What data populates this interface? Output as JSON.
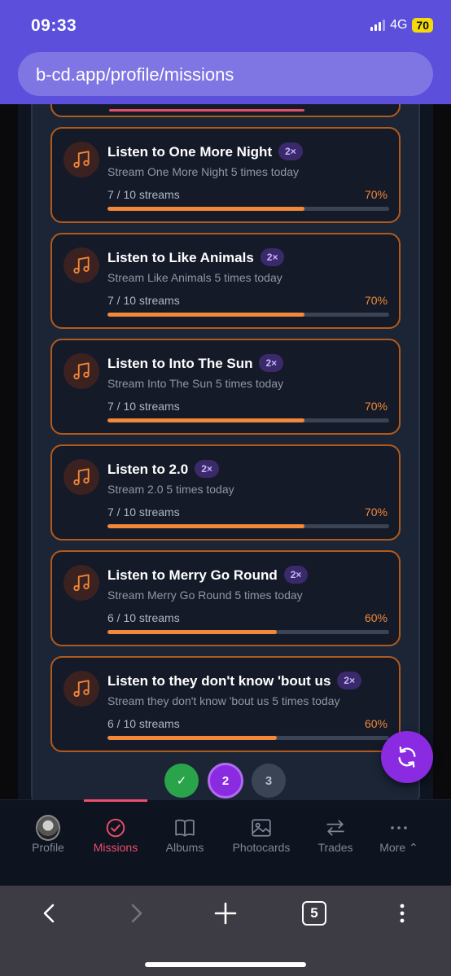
{
  "status": {
    "time": "09:33",
    "network": "4G",
    "battery": "70"
  },
  "browser": {
    "url": "b-cd.app/profile/missions",
    "tab_count": "5"
  },
  "missions": [
    {
      "title": "Listen to One More Night",
      "multiplier": "2×",
      "subtitle": "Stream One More Night 5 times today",
      "progress_text": "7 / 10 streams",
      "percent_text": "70%",
      "progress": 0.7
    },
    {
      "title": "Listen to Like Animals",
      "multiplier": "2×",
      "subtitle": "Stream Like Animals 5 times today",
      "progress_text": "7 / 10 streams",
      "percent_text": "70%",
      "progress": 0.7
    },
    {
      "title": "Listen to Into The Sun",
      "multiplier": "2×",
      "subtitle": "Stream Into The Sun 5 times today",
      "progress_text": "7 / 10 streams",
      "percent_text": "70%",
      "progress": 0.7
    },
    {
      "title": "Listen to 2.0",
      "multiplier": "2×",
      "subtitle": "Stream 2.0 5 times today",
      "progress_text": "7 / 10 streams",
      "percent_text": "70%",
      "progress": 0.7
    },
    {
      "title": "Listen to Merry Go Round",
      "multiplier": "2×",
      "subtitle": "Stream Merry Go Round 5 times today",
      "progress_text": "6 / 10 streams",
      "percent_text": "60%",
      "progress": 0.6
    },
    {
      "title": "Listen to they don't know 'bout us",
      "multiplier": "2×",
      "subtitle": "Stream they don't know 'bout us 5 times today",
      "progress_text": "6 / 10 streams",
      "percent_text": "60%",
      "progress": 0.6
    }
  ],
  "pagination": {
    "page1": "✓",
    "page2": "2",
    "page3": "3"
  },
  "nav": {
    "profile": "Profile",
    "missions": "Missions",
    "albums": "Albums",
    "photocards": "Photocards",
    "trades": "Trades",
    "more": "More"
  },
  "colors": {
    "accent": "#f2883a",
    "active": "#ef4d6a",
    "purple": "#8a2be2",
    "success": "#2aa44a"
  }
}
